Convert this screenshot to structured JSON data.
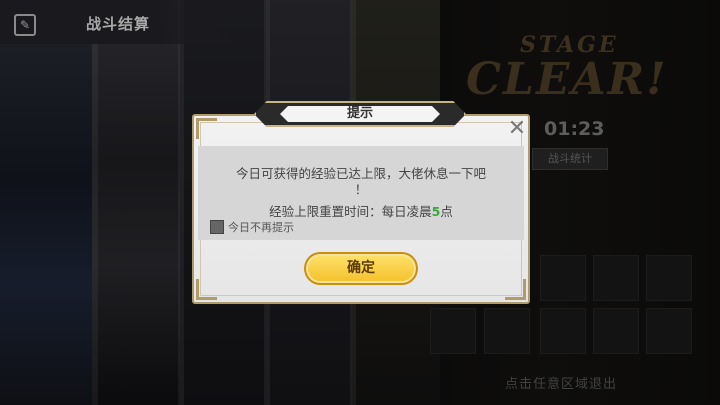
{
  "header": {
    "title": "战斗结算"
  },
  "result": {
    "stage_text": "STAGE",
    "clear_text": "CLEAR!",
    "timer": "01:23",
    "stats_button": "战斗统计"
  },
  "footer": {
    "exit_hint": "点击任意区域退出"
  },
  "dialog": {
    "title": "提示",
    "message_line1": "今日可获得的经验已达上限，大佬休息一下吧",
    "message_line1_tail": "！",
    "message_line2_prefix": "经验上限重置时间：每日凌晨",
    "message_line2_hour": "5",
    "message_line2_suffix": "点",
    "checkbox_label": "今日不再提示",
    "checkbox_checked": false,
    "confirm_label": "确定"
  },
  "colors": {
    "highlight": "#3aa83a",
    "confirm_button": "#f5bf2a",
    "gold_border": "#b09c6a"
  },
  "icons": {
    "back": "back-icon",
    "close": "close-icon"
  }
}
